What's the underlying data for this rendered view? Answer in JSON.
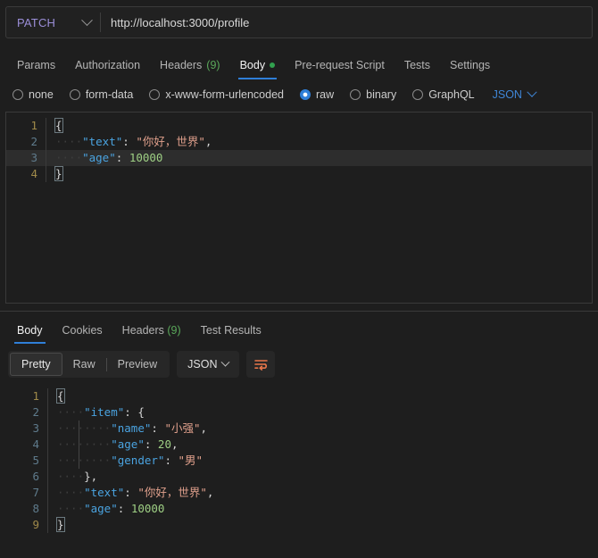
{
  "request": {
    "method": "PATCH",
    "url": "http://localhost:3000/profile",
    "url_placeholder": "Enter request URL",
    "tabs": [
      {
        "label": "Params",
        "active": false,
        "badge": "",
        "dot": false
      },
      {
        "label": "Authorization",
        "active": false,
        "badge": "",
        "dot": false
      },
      {
        "label": "Headers",
        "active": false,
        "badge": "(9)",
        "dot": false
      },
      {
        "label": "Body",
        "active": true,
        "badge": "",
        "dot": true
      },
      {
        "label": "Pre-request Script",
        "active": false,
        "badge": "",
        "dot": false
      },
      {
        "label": "Tests",
        "active": false,
        "badge": "",
        "dot": false
      },
      {
        "label": "Settings",
        "active": false,
        "badge": "",
        "dot": false
      }
    ],
    "body_types": [
      {
        "label": "none",
        "selected": false
      },
      {
        "label": "form-data",
        "selected": false
      },
      {
        "label": "x-www-form-urlencoded",
        "selected": false
      },
      {
        "label": "raw",
        "selected": true
      },
      {
        "label": "binary",
        "selected": false
      },
      {
        "label": "GraphQL",
        "selected": false
      }
    ],
    "raw_format": "JSON",
    "editor": {
      "active_line": 3,
      "lines": [
        {
          "n": "1",
          "bracket": true,
          "indent": "",
          "tokens": [
            {
              "t": "brk",
              "v": "{"
            }
          ]
        },
        {
          "n": "2",
          "bracket": false,
          "indent": "    ",
          "tokens": [
            {
              "t": "key",
              "v": "\"text\""
            },
            {
              "t": "pun",
              "v": ": "
            },
            {
              "t": "str",
              "v": "\"你好，世界\""
            },
            {
              "t": "pun",
              "v": ","
            }
          ]
        },
        {
          "n": "3",
          "bracket": false,
          "indent": "    ",
          "tokens": [
            {
              "t": "key",
              "v": "\"age\""
            },
            {
              "t": "pun",
              "v": ": "
            },
            {
              "t": "num",
              "v": "10000"
            }
          ]
        },
        {
          "n": "4",
          "bracket": true,
          "indent": "",
          "tokens": [
            {
              "t": "brk",
              "v": "}"
            }
          ]
        }
      ]
    }
  },
  "response": {
    "tabs": [
      {
        "label": "Body",
        "active": true,
        "badge": ""
      },
      {
        "label": "Cookies",
        "active": false,
        "badge": ""
      },
      {
        "label": "Headers",
        "active": false,
        "badge": "(9)"
      },
      {
        "label": "Test Results",
        "active": false,
        "badge": ""
      }
    ],
    "view_modes": [
      {
        "label": "Pretty",
        "active": true
      },
      {
        "label": "Raw",
        "active": false
      },
      {
        "label": "Preview",
        "active": false
      }
    ],
    "format": "JSON",
    "wrap_icon": "word-wrap-icon",
    "body": {
      "lines": [
        {
          "n": "1",
          "bracket": true,
          "indent": "",
          "tokens": [
            {
              "t": "brk",
              "v": "{"
            }
          ]
        },
        {
          "n": "2",
          "bracket": false,
          "indent": "    ",
          "tokens": [
            {
              "t": "key",
              "v": "\"item\""
            },
            {
              "t": "pun",
              "v": ": "
            },
            {
              "t": "pun",
              "v": "{"
            }
          ]
        },
        {
          "n": "3",
          "bracket": false,
          "indent": "        ",
          "tokens": [
            {
              "t": "key",
              "v": "\"name\""
            },
            {
              "t": "pun",
              "v": ": "
            },
            {
              "t": "str",
              "v": "\"小强\""
            },
            {
              "t": "pun",
              "v": ","
            }
          ]
        },
        {
          "n": "4",
          "bracket": false,
          "indent": "        ",
          "tokens": [
            {
              "t": "key",
              "v": "\"age\""
            },
            {
              "t": "pun",
              "v": ": "
            },
            {
              "t": "num",
              "v": "20"
            },
            {
              "t": "pun",
              "v": ","
            }
          ]
        },
        {
          "n": "5",
          "bracket": false,
          "indent": "        ",
          "tokens": [
            {
              "t": "key",
              "v": "\"gender\""
            },
            {
              "t": "pun",
              "v": ": "
            },
            {
              "t": "str",
              "v": "\"男\""
            }
          ]
        },
        {
          "n": "6",
          "bracket": false,
          "indent": "    ",
          "tokens": [
            {
              "t": "pun",
              "v": "},"
            }
          ]
        },
        {
          "n": "7",
          "bracket": false,
          "indent": "    ",
          "tokens": [
            {
              "t": "key",
              "v": "\"text\""
            },
            {
              "t": "pun",
              "v": ": "
            },
            {
              "t": "str",
              "v": "\"你好，世界\""
            },
            {
              "t": "pun",
              "v": ","
            }
          ]
        },
        {
          "n": "8",
          "bracket": false,
          "indent": "    ",
          "tokens": [
            {
              "t": "key",
              "v": "\"age\""
            },
            {
              "t": "pun",
              "v": ": "
            },
            {
              "t": "num",
              "v": "10000"
            }
          ]
        },
        {
          "n": "9",
          "bracket": true,
          "indent": "",
          "tokens": [
            {
              "t": "brk",
              "v": "}"
            }
          ]
        }
      ]
    }
  },
  "colors": {
    "accent_blue": "#2f7fd8",
    "method_patch": "#9b8ed8",
    "json_key": "#4aa3e0",
    "json_string": "#e0a08c",
    "json_number": "#9ecf84",
    "green_dot": "#31a14e",
    "wrap_orange": "#e8764a"
  }
}
